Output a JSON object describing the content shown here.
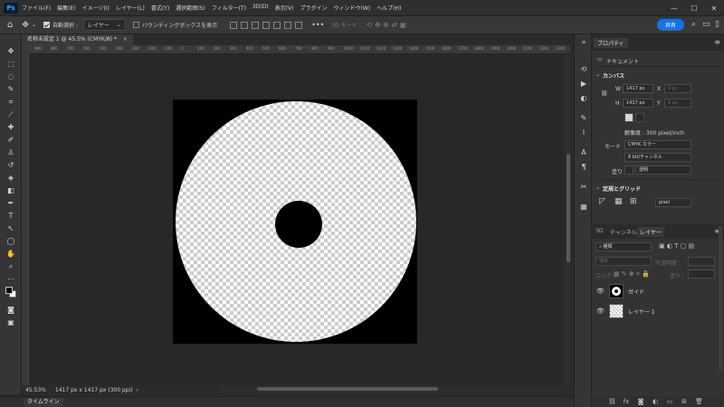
{
  "app": {
    "logo": "Ps"
  },
  "menu": [
    "ファイル(F)",
    "編集(E)",
    "イメージ(I)",
    "レイヤー(L)",
    "書式(Y)",
    "選択範囲(S)",
    "フィルター(T)",
    "3D(D)",
    "表示(V)",
    "プラグイン",
    "ウィンドウ(W)",
    "ヘルプ(H)"
  ],
  "window_controls": {
    "minimize": "—",
    "maximize": "☐",
    "close": "✕"
  },
  "options": {
    "auto_select_label": "自動選択 :",
    "auto_select_target": "レイヤー",
    "bounding_box_label": "バウンディングボックスを表示",
    "mode3d_label": "3D モード :",
    "share_label": "共有"
  },
  "document_tab": {
    "title": "名称未設定 1 @ 45.5% (CMYK/8) *",
    "close": "×"
  },
  "ruler_ticks": [
    "900",
    "800",
    "700",
    "600",
    "500",
    "400",
    "300",
    "200",
    "100",
    "0",
    "100",
    "200",
    "300",
    "400",
    "500",
    "600",
    "700",
    "800",
    "900",
    "1000",
    "1100",
    "1200",
    "1300",
    "1400",
    "1500",
    "1600",
    "1700",
    "1800",
    "1900",
    "2000",
    "2100",
    "2200",
    "2300"
  ],
  "status": {
    "zoom": "45.53%",
    "doc_info": "1417 px x 1417 px (300 ppi)"
  },
  "timeline": {
    "label": "タイムライン"
  },
  "properties": {
    "tab": "プロパティ",
    "doc_label": "ドキュメント",
    "canvas_label": "カンバス",
    "w_label": "W",
    "w_value": "1417 px",
    "h_label": "H",
    "h_value": "1417 px",
    "x_label": "X",
    "x_placeholder": "0 px",
    "y_label": "Y",
    "y_placeholder": "0 px",
    "resolution": "解像度 : 300 pixel/inch",
    "mode_label": "モード",
    "mode_value": "CMYK カラー",
    "depth_value": "8 bit/チャンネル",
    "fill_label": "塗り",
    "fill_value": "透明",
    "rulers_label": "定規とグリッド",
    "unit_value": "pixel"
  },
  "layers_panel": {
    "tabs": [
      "3D",
      "チャンネル",
      "レイヤー"
    ],
    "filter_label": "種類",
    "blend_mode": "通常",
    "opacity_label": "不透明度 :",
    "lock_label": "ロック :",
    "fill_label": "塗り :",
    "layers": [
      {
        "name": "ガイド"
      },
      {
        "name": "レイヤー 1"
      }
    ]
  }
}
